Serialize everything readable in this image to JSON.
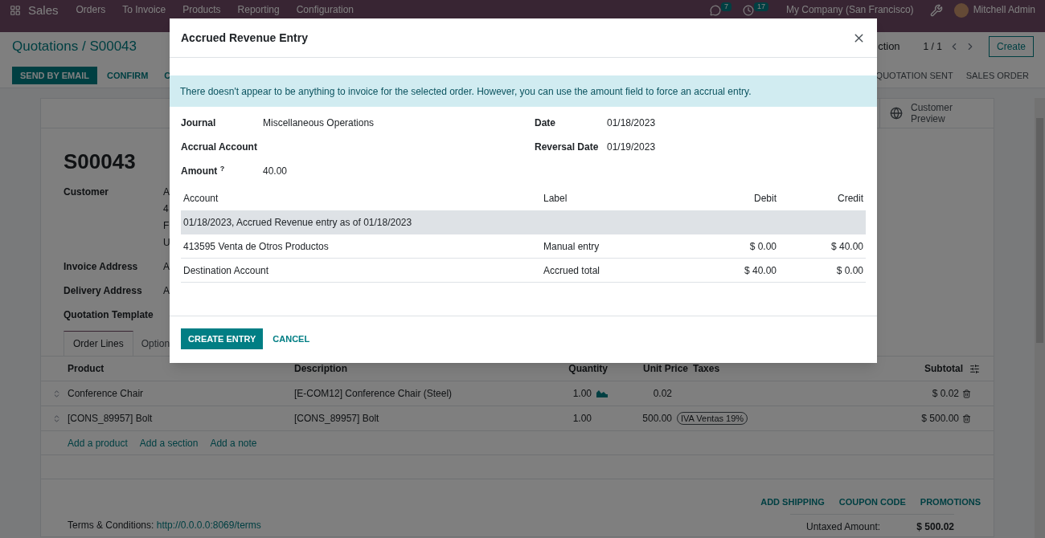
{
  "navbar": {
    "app": "Sales",
    "menu": [
      "Orders",
      "To Invoice",
      "Products",
      "Reporting",
      "Configuration"
    ],
    "messages_count": "7",
    "activities_count": "17",
    "company": "My Company (San Francisco)",
    "user": "Mitchell Admin"
  },
  "breadcrumb": "Quotations / S00043",
  "action_label": "ction",
  "pager": "1 / 1",
  "create_button": "Create",
  "buttons": [
    {
      "label": "SEND BY EMAIL",
      "kind": "primary"
    },
    {
      "label": "CONFIRM",
      "kind": "secondary"
    },
    {
      "label": "C",
      "kind": "secondary"
    }
  ],
  "status_steps": [
    "QUOTATION SENT",
    "SALES ORDER"
  ],
  "smart_button": "Customer Preview",
  "order_name": "S00043",
  "fields": [
    {
      "label": "Customer",
      "value_lines": [
        "A",
        "4",
        "F",
        "U"
      ]
    },
    {
      "label": "Invoice Address",
      "value_lines": [
        "A"
      ]
    },
    {
      "label": "Delivery Address",
      "value_lines": [
        "A"
      ]
    },
    {
      "label": "Quotation Template"
    }
  ],
  "tabs": [
    {
      "label": "Order Lines",
      "selected": true
    },
    {
      "label": "Option",
      "selected": false
    }
  ],
  "lines": {
    "columns": [
      "Product",
      "Description",
      "Quantity",
      "Unit Price",
      "Taxes",
      "Subtotal"
    ],
    "rows": [
      {
        "product": "Conference Chair",
        "description": "[E-COM12] Conference Chair (Steel)",
        "quantity": "1.00",
        "forecast": true,
        "unit_price": "0.02",
        "subtotal": "$ 0.02"
      },
      {
        "product": "[CONS_89957] Bolt",
        "description": "[CONS_89957] Bolt",
        "quantity": "1.00",
        "forecast": false,
        "unit_price": "500.00",
        "taxes": [
          "IVA Ventas 19%"
        ],
        "subtotal": "$ 500.00"
      }
    ]
  },
  "add_links": [
    "Add a product",
    "Add a section",
    "Add a note"
  ],
  "footer_buttons": [
    "ADD SHIPPING",
    "COUPON CODE",
    "PROMOTIONS"
  ],
  "terms": {
    "label": "Terms & Conditions:",
    "link": "http://0.0.0.0:8069/terms"
  },
  "untaxed": {
    "label": "Untaxed Amount:",
    "value": "$ 500.02"
  },
  "dialog": {
    "title": "Accrued Revenue Entry",
    "alert": "There doesn't appear to be anything to invoice for the selected order. However, you can use the amount field to force an accrual entry.",
    "left_fields": [
      {
        "label": "Journal",
        "value": "Miscellaneous Operations"
      },
      {
        "label": "Accrual Account"
      },
      {
        "label": "Amount $^{?}$",
        "value": "40.00"
      }
    ],
    "right_fields": [
      {
        "label": "Date",
        "value": "01/18/2023"
      },
      {
        "label": "Reversal Date",
        "value": "01/19/2023"
      }
    ],
    "table": {
      "columns": [
        "Account",
        "Label",
        "Debit",
        "Credit"
      ],
      "section": "01/18/2023, Accrued Revenue entry as of 01/18/2023",
      "rows": [
        {
          "account": "413595 Venta de Otros Productos",
          "label": "Manual entry",
          "debit": "$ 0.00",
          "credit": "$ 40.00"
        },
        {
          "account": "Destination Account",
          "label": "Accrued total",
          "debit": "$ 40.00",
          "credit": "$ 0.00"
        }
      ]
    },
    "buttons": [
      {
        "label": "CREATE ENTRY",
        "kind": "primary"
      },
      {
        "label": "CANCEL",
        "kind": "link"
      }
    ]
  }
}
